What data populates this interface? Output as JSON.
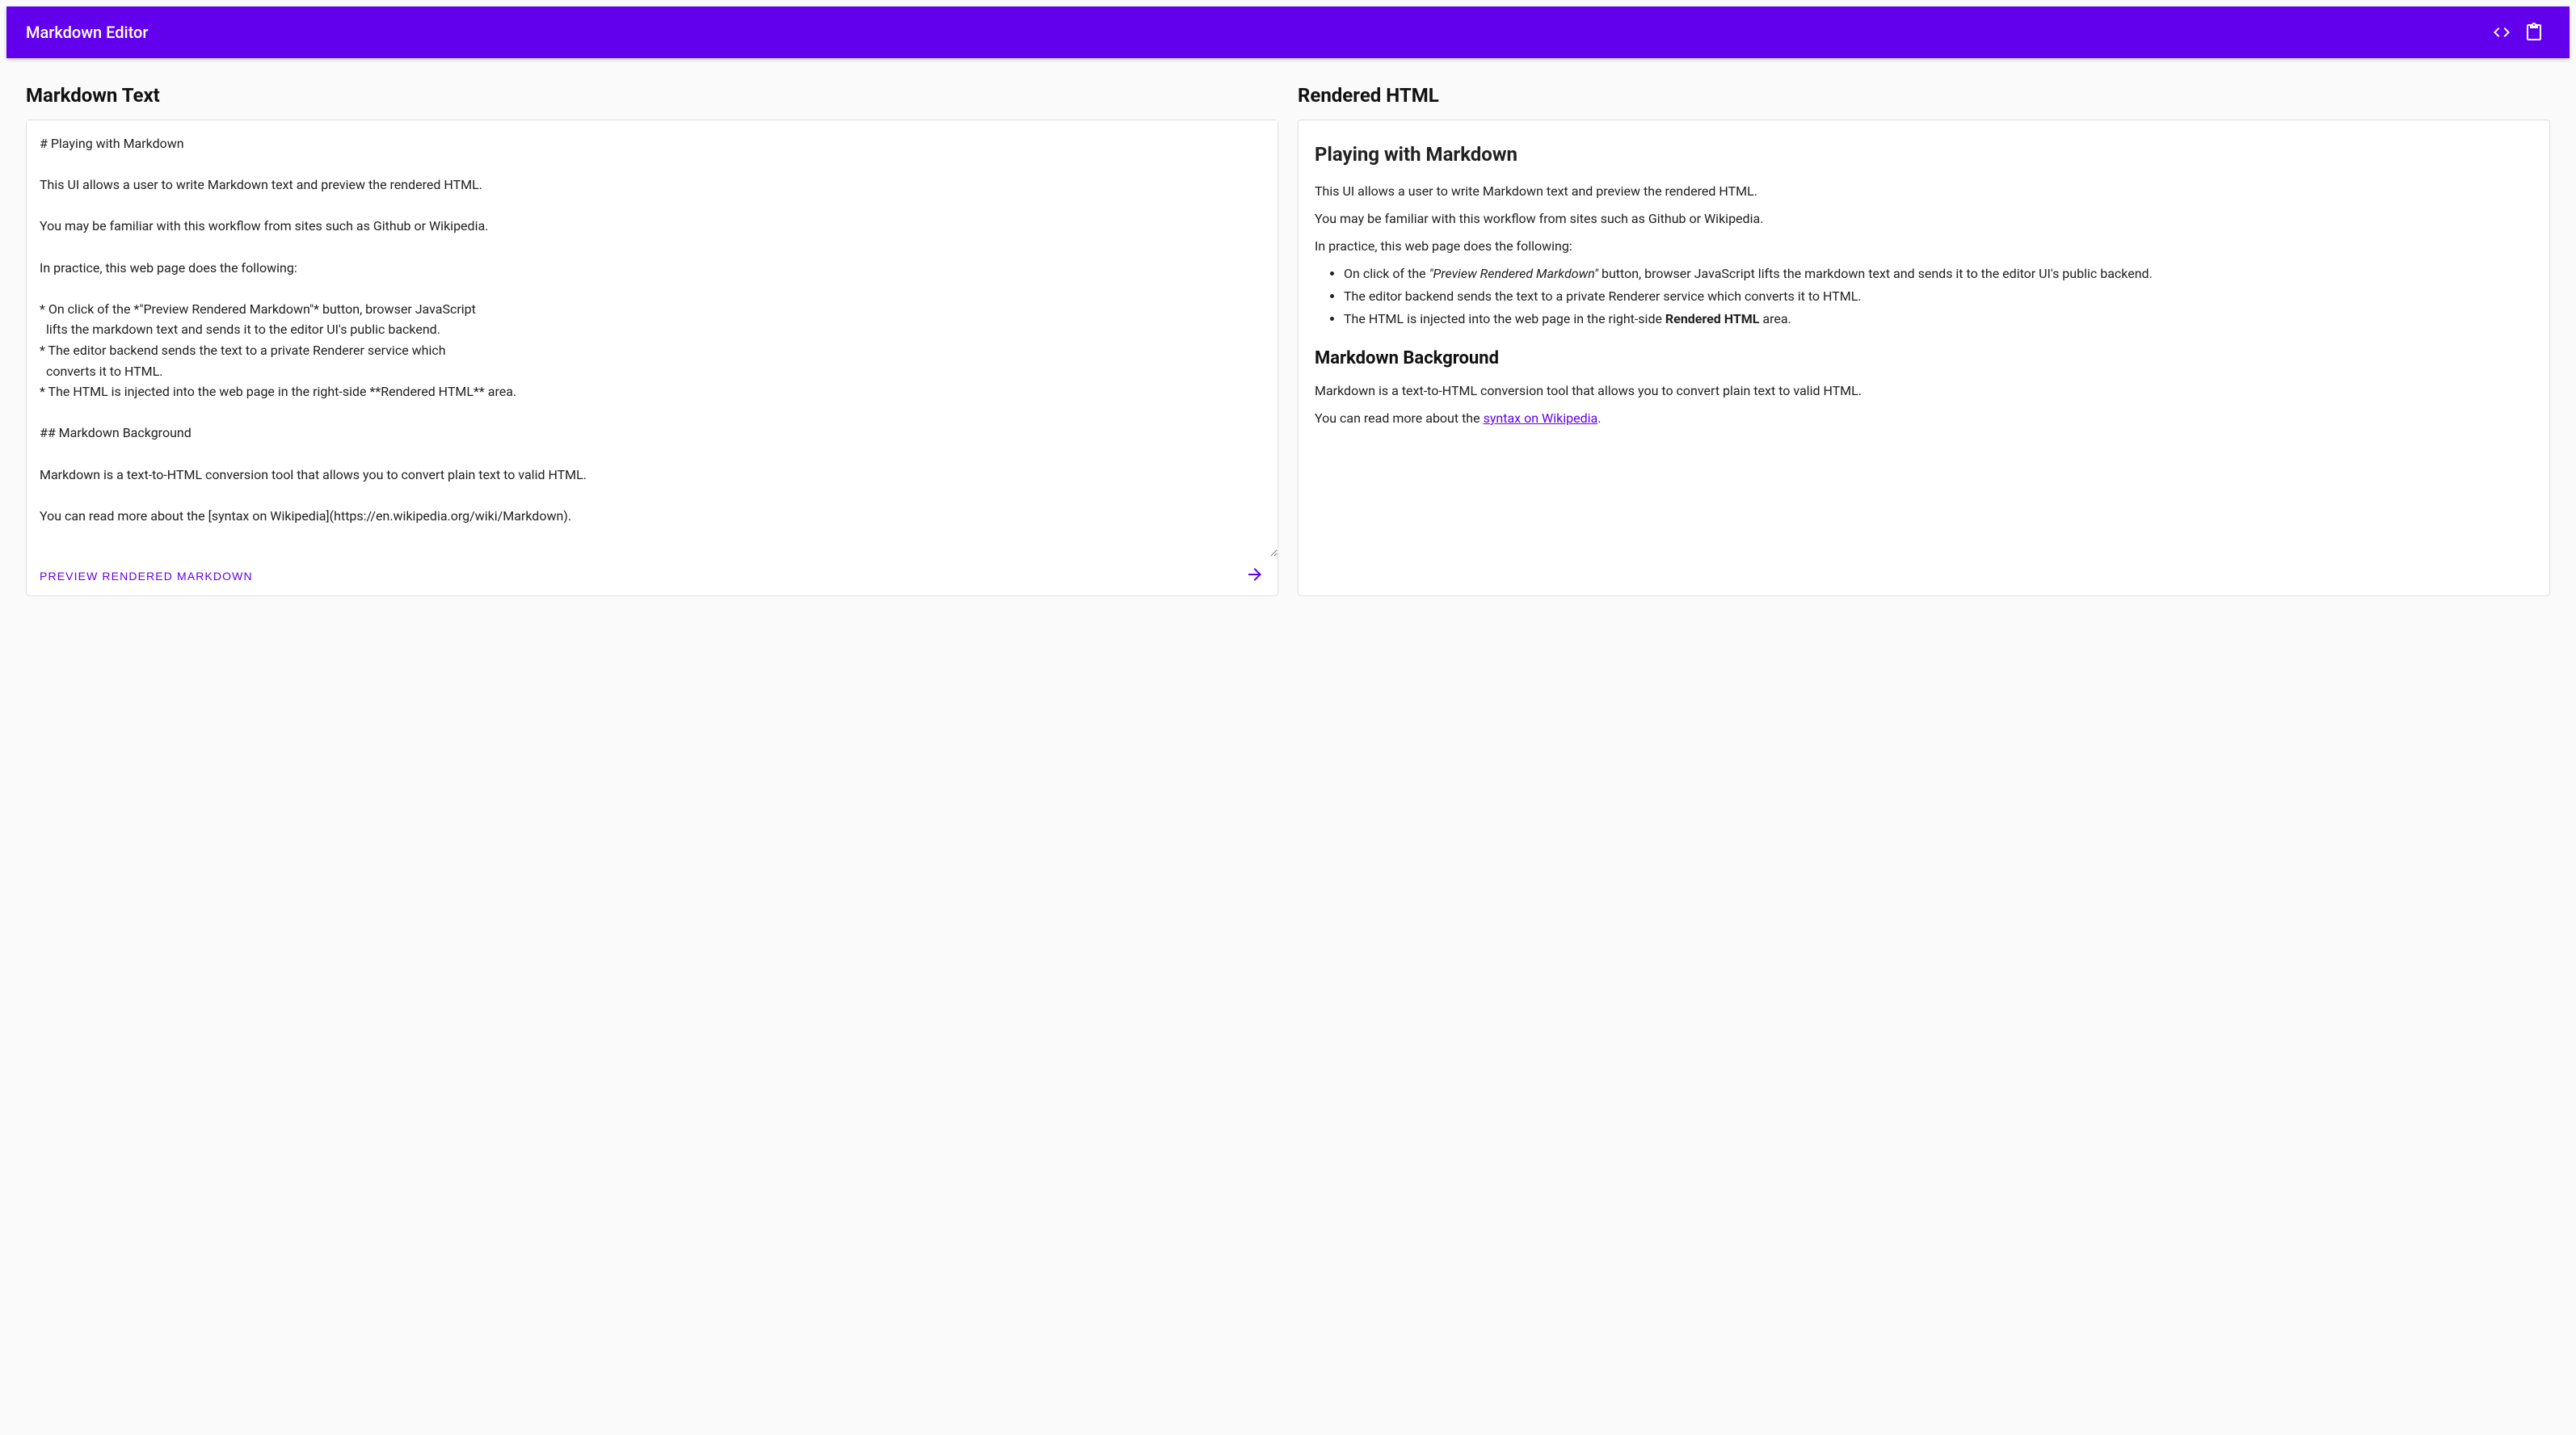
{
  "colors": {
    "primary": "#6200ee"
  },
  "header": {
    "title": "Markdown Editor",
    "icons": [
      "code-icon",
      "clipboard-icon"
    ]
  },
  "left": {
    "heading": "Markdown Text",
    "textarea_value": "# Playing with Markdown\n\nThis UI allows a user to write Markdown text and preview the rendered HTML.\n\nYou may be familiar with this workflow from sites such as Github or Wikipedia.\n\nIn practice, this web page does the following:\n\n* On click of the *\"Preview Rendered Markdown\"* button, browser JavaScript\n  lifts the markdown text and sends it to the editor UI's public backend.\n* The editor backend sends the text to a private Renderer service which\n  converts it to HTML.\n* The HTML is injected into the web page in the right-side **Rendered HTML** area.\n\n## Markdown Background\n\nMarkdown is a text-to-HTML conversion tool that allows you to convert plain text to valid HTML.\n\nYou can read more about the [syntax on Wikipedia](https://en.wikipedia.org/wiki/Markdown).",
    "preview_button_label": "Preview Rendered Markdown"
  },
  "right": {
    "heading": "Rendered HTML",
    "h1": "Playing with Markdown",
    "p1": "This UI allows a user to write Markdown text and preview the rendered HTML.",
    "p2": "You may be familiar with this workflow from sites such as Github or Wikipedia.",
    "p3": "In practice, this web page does the following:",
    "li1_a": "On click of the ",
    "li1_em": "\"Preview Rendered Markdown\"",
    "li1_b": " button, browser JavaScript lifts the markdown text and sends it to the editor UI's public backend.",
    "li2": "The editor backend sends the text to a private Renderer service which converts it to HTML.",
    "li3_a": "The HTML is injected into the web page in the right-side ",
    "li3_strong": "Rendered HTML",
    "li3_b": " area.",
    "h2": "Markdown Background",
    "p4": "Markdown is a text-to-HTML conversion tool that allows you to convert plain text to valid HTML.",
    "p5_a": "You can read more about the ",
    "p5_link": "syntax on Wikipedia",
    "p5_b": "."
  }
}
